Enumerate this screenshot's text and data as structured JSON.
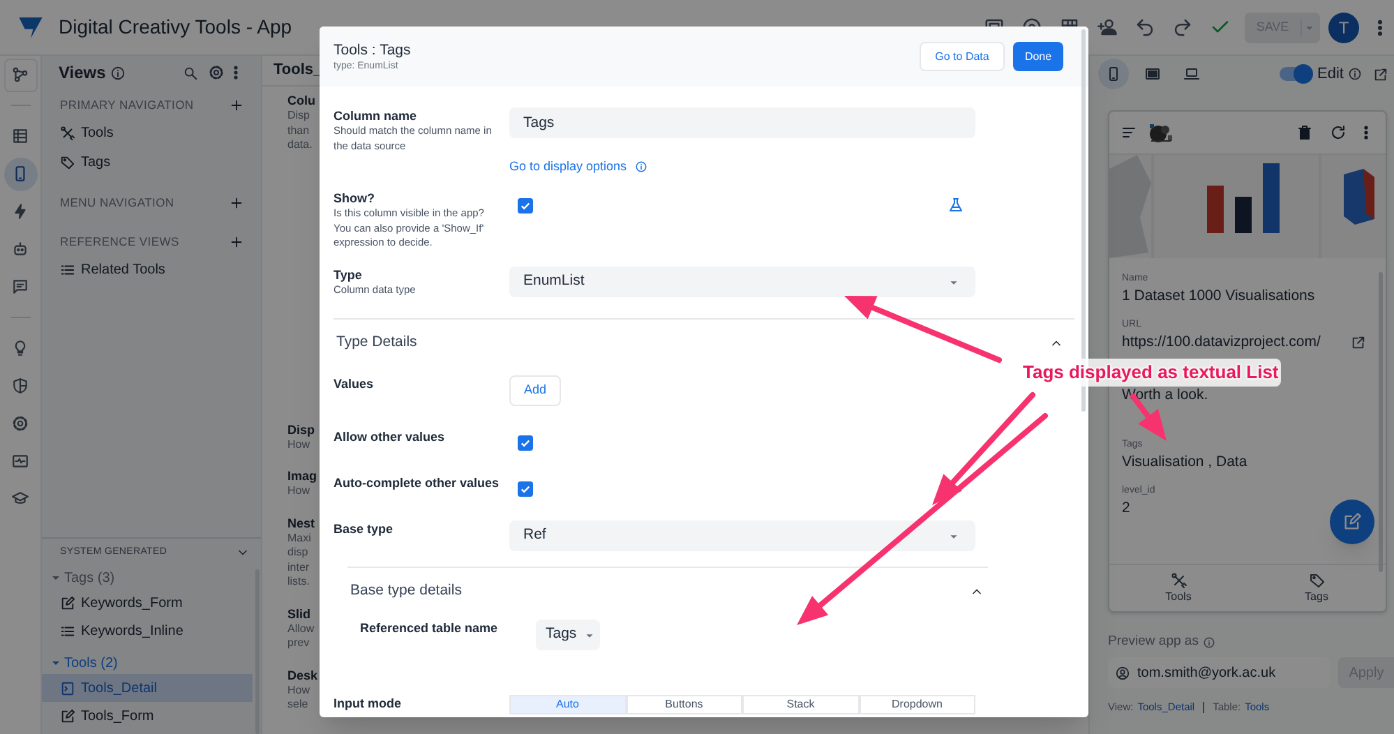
{
  "app": {
    "title": "Digital Creativy Tools - App"
  },
  "top_bar": {
    "save": {
      "label": "SAVE",
      "disabled": true
    },
    "avatar": "T"
  },
  "rail": [
    [
      {
        "kind": "nodes",
        "selected": false
      }
    ],
    [
      {
        "kind": "table",
        "selected": false
      },
      {
        "kind": "phone",
        "selected": true
      },
      {
        "kind": "bolt",
        "selected": false
      },
      {
        "kind": "robot",
        "selected": false
      },
      {
        "kind": "chat",
        "selected": false
      }
    ],
    [
      {
        "kind": "bulb",
        "selected": false
      },
      {
        "kind": "shield",
        "selected": false
      },
      {
        "kind": "gear",
        "selected": false
      },
      {
        "kind": "monitor",
        "selected": false
      },
      {
        "kind": "cap",
        "selected": false
      }
    ]
  ],
  "views_panel": {
    "title": "Views",
    "sections": [
      {
        "heading": "PRIMARY NAVIGATION",
        "items": [
          {
            "label": "Tools",
            "kind": "tools"
          },
          {
            "label": "Tags",
            "kind": "tag"
          }
        ]
      },
      {
        "heading": "MENU NAVIGATION"
      },
      {
        "heading": "REFERENCE VIEWS",
        "items": [
          {
            "label": "Related Tools",
            "kind": "list"
          }
        ]
      }
    ],
    "system_generated": {
      "heading": "SYSTEM GENERATED",
      "expanded": true,
      "groups": [
        {
          "label": "Tags (3)",
          "expanded": true,
          "children": [
            {
              "label": "Keywords_Form",
              "kind": "form",
              "selected": false
            },
            {
              "label": "Keywords_Inline",
              "kind": "list",
              "selected": false
            }
          ]
        },
        {
          "label": "Tools (2)",
          "expanded": true,
          "children": [
            {
              "label": "Tools_Detail",
              "kind": "detail",
              "selected": true
            },
            {
              "label": "Tools_Form",
              "kind": "form",
              "selected": false
            }
          ]
        }
      ]
    }
  },
  "middle_column": {
    "title": "Tools_",
    "groups": [
      {
        "title": "Colu",
        "lines": [
          "Disp",
          "than",
          "data."
        ]
      },
      {
        "title": "Disp",
        "lines": [
          "How"
        ]
      },
      {
        "title": "Imag",
        "lines": [
          "How"
        ]
      },
      {
        "title": "Nest",
        "lines": [
          "Maxi",
          "disp",
          "inter",
          "lists."
        ]
      },
      {
        "title": "Slid",
        "lines": [
          "Allow",
          "prev"
        ]
      },
      {
        "title": "Desk",
        "lines": [
          "How",
          "sele"
        ]
      }
    ]
  },
  "modal": {
    "title": "Tools : Tags",
    "subtitle": "type: EnumList",
    "buttons": [
      {
        "label": "Go to Data",
        "kind": "secondary"
      },
      {
        "label": "Done",
        "kind": "primary"
      }
    ],
    "fields": [
      {
        "kind": "text",
        "label": "Column name",
        "description": "Should match the column name in the data source",
        "value": "Tags"
      },
      {
        "kind": "link",
        "label": "Go to display options"
      },
      {
        "kind": "checkbox",
        "label": "Show?",
        "description": "Is this column visible in the app? You can also provide a 'Show_If' expression to decide.",
        "checked": true,
        "expression": true
      },
      {
        "kind": "select",
        "label": "Type",
        "description": "Column data type",
        "value": "EnumList"
      },
      {
        "kind": "section",
        "label": "Type Details",
        "expanded": true,
        "fields": [
          {
            "kind": "button",
            "label": "Values",
            "button": "Add"
          },
          {
            "kind": "checkbox",
            "label": "Allow other values",
            "checked": true
          },
          {
            "kind": "checkbox",
            "label": "Auto-complete other values",
            "checked": true
          },
          {
            "kind": "select",
            "label": "Base type",
            "value": "Ref"
          },
          {
            "kind": "section",
            "label": "Base type details",
            "expanded": true,
            "fields": [
              {
                "kind": "select_small",
                "label": "Referenced table name",
                "value": "Tags"
              }
            ]
          },
          {
            "kind": "segmented",
            "label": "Input mode",
            "options": [
              {
                "label": "Auto",
                "selected": true
              },
              {
                "label": "Buttons",
                "selected": false
              },
              {
                "label": "Stack",
                "selected": false
              },
              {
                "label": "Dropdown",
                "selected": false
              }
            ]
          }
        ]
      }
    ]
  },
  "right_panel": {
    "devices": [
      {
        "kind": "phone",
        "selected": true
      },
      {
        "kind": "tablet",
        "selected": false
      },
      {
        "kind": "laptop",
        "selected": false
      }
    ],
    "edit": {
      "label": "Edit",
      "on": true
    },
    "preview": {
      "fields": [
        {
          "label": "Name",
          "value": "1 Dataset 1000 Visualisations"
        },
        {
          "label": "URL",
          "value": "https://100.datavizproject.com/",
          "kind": "url"
        },
        {
          "value": "Worth a look."
        },
        {
          "label": "Tags",
          "value": "Visualisation , Data"
        },
        {
          "label": "level_id",
          "value": "2"
        }
      ],
      "nav": [
        {
          "label": "Tools",
          "kind": "tools"
        },
        {
          "label": "Tags",
          "kind": "tag"
        }
      ]
    },
    "preview_as": {
      "label": "Preview app as",
      "value": "tom.smith@york.ac.uk",
      "button": "Apply"
    },
    "footer": [
      {
        "label": "View:",
        "value": "Tools_Detail"
      },
      {
        "label": "Table:",
        "value": "Tools"
      }
    ]
  },
  "annotation": {
    "text": "Tags displayed as textual List"
  }
}
